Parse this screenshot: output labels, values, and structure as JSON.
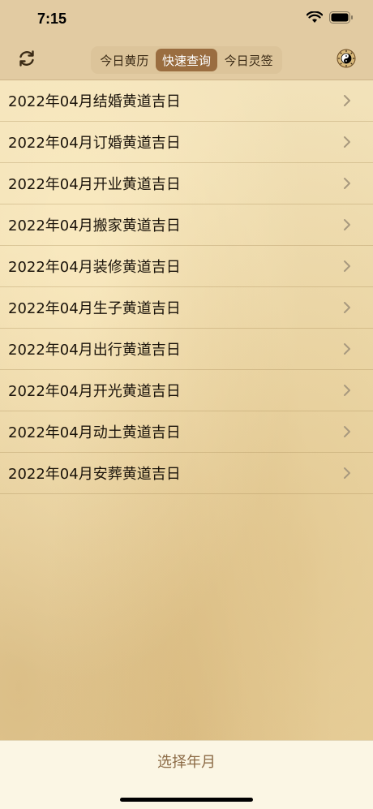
{
  "status": {
    "time": "7:15"
  },
  "nav": {
    "segments": [
      {
        "label": "今日黄历"
      },
      {
        "label": "快速查询"
      },
      {
        "label": "今日灵签"
      }
    ],
    "active_segment": "快速查询"
  },
  "list": {
    "items": [
      {
        "label": "2022年04月结婚黄道吉日"
      },
      {
        "label": "2022年04月订婚黄道吉日"
      },
      {
        "label": "2022年04月开业黄道吉日"
      },
      {
        "label": "2022年04月搬家黄道吉日"
      },
      {
        "label": "2022年04月装修黄道吉日"
      },
      {
        "label": "2022年04月生子黄道吉日"
      },
      {
        "label": "2022年04月出行黄道吉日"
      },
      {
        "label": "2022年04月开光黄道吉日"
      },
      {
        "label": "2022年04月动土黄道吉日"
      },
      {
        "label": "2022年04月安葬黄道吉日"
      }
    ]
  },
  "bottom": {
    "select_label": "选择年月"
  },
  "icons": {
    "refresh": "refresh-icon",
    "yinyang": "yinyang-icon",
    "chevron": "chevron-right-icon"
  },
  "colors": {
    "accent": "#9a6d40",
    "nav_background": "#e2cba2",
    "bottom_text": "#8b6a45"
  }
}
